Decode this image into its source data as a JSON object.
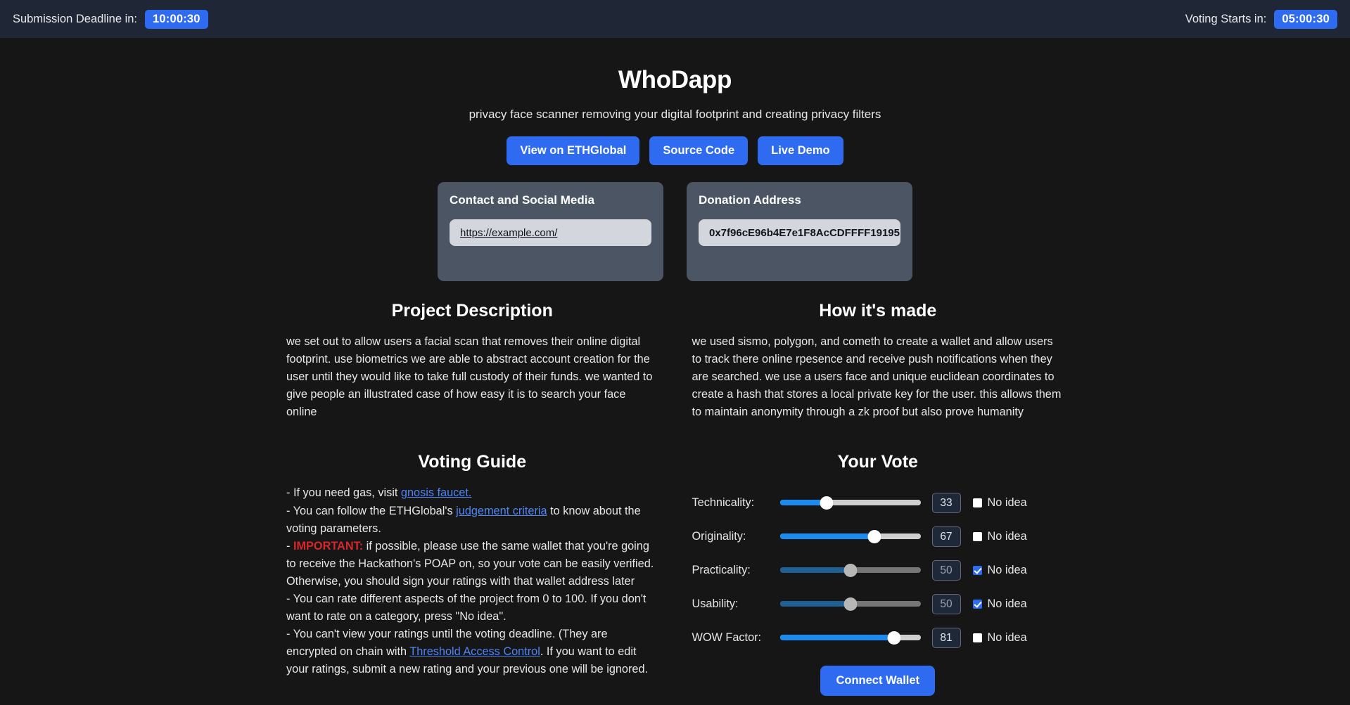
{
  "navbar": {
    "submission_label": "Submission Deadline in:",
    "submission_timer": "10:00:30",
    "voting_label": "Voting Starts in:",
    "voting_timer": "05:00:30",
    "accent": "#2f6bf0",
    "background": "#1f2736"
  },
  "hero": {
    "title": "WhoDapp",
    "tagline": "privacy face scanner removing your digital footprint and creating privacy filters",
    "buttons": [
      {
        "label": "View on ETHGlobal"
      },
      {
        "label": "Source Code"
      },
      {
        "label": "Live Demo"
      }
    ]
  },
  "cards": {
    "contact": {
      "title": "Contact and Social Media",
      "link_text": "https://example.com/"
    },
    "donation": {
      "title": "Donation Address",
      "address": "0x7f96cE96b4E7e1F8AcCDFFFF19195…"
    }
  },
  "description": {
    "heading": "Project Description",
    "body": "we set out to allow users a facial scan that removes their online digital footprint. use biometrics we are able to abstract account creation for the user until they would like to take full custody of their funds. we wanted to give people an illustrated case of how easy it is to search your face online"
  },
  "how_its_made": {
    "heading": "How it's made",
    "body": "we used sismo, polygon, and cometh to create a wallet and allow users to track there online rpesence and receive push notifications when they are searched. we use a users face and unique euclidean coordinates to create a hash that stores a local private key for the user. this allows them to maintain anonymity through a zk proof but also prove humanity"
  },
  "voting_guide": {
    "heading": "Voting Guide",
    "line1_pre": "- If you need gas, visit ",
    "line1_link": "gnosis faucet.",
    "line2_pre": "- You can follow the ETHGlobal's ",
    "line2_link": "judgement criteria",
    "line2_post": " to know about the voting parameters.",
    "line3_dash": "- ",
    "line3_important": "IMPORTANT:",
    "line3_post": " if possible, please use the same wallet that you're going to receive the Hackathon's POAP on, so your vote can be easily verified. Otherwise, you should sign your ratings with that wallet address later",
    "line4": "- You can rate different aspects of the project from 0 to 100. If you don't want to rate on a category, press \"No idea\".",
    "line5_pre": "- You can't view your ratings until the voting deadline. (They are encrypted on chain with ",
    "line5_link": "Threshold Access Control",
    "line5_post": ". If you want to edit your ratings, submit a new rating and your previous one will be ignored."
  },
  "vote": {
    "heading": "Your Vote",
    "no_idea_label": "No idea",
    "connect_label": "Connect Wallet",
    "slider_min": 0,
    "slider_max": 100,
    "rows": [
      {
        "label": "Technicality:",
        "value": "33",
        "percent": 33,
        "no_idea": false
      },
      {
        "label": "Originality:",
        "value": "67",
        "percent": 67,
        "no_idea": false
      },
      {
        "label": "Practicality:",
        "value": "50",
        "percent": 50,
        "no_idea": true
      },
      {
        "label": "Usability:",
        "value": "50",
        "percent": 50,
        "no_idea": true
      },
      {
        "label": "WOW Factor:",
        "value": "81",
        "percent": 81,
        "no_idea": false
      }
    ]
  }
}
